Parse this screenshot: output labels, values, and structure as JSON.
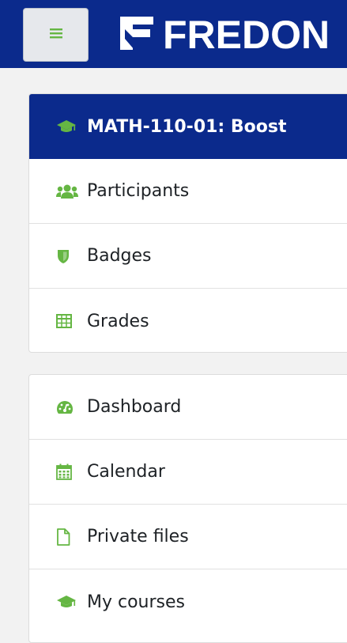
{
  "header": {
    "logo_text": "FREDON",
    "menu_icon": "hamburger-icon",
    "colors": {
      "bar": "#0b2a8c",
      "accent": "#65b643"
    }
  },
  "course_nav": {
    "items": [
      {
        "label": "MATH-110-01: Boost",
        "icon": "graduation-cap-icon",
        "active": true
      },
      {
        "label": "Participants",
        "icon": "users-icon"
      },
      {
        "label": "Badges",
        "icon": "shield-icon"
      },
      {
        "label": "Grades",
        "icon": "table-icon"
      }
    ]
  },
  "site_nav": {
    "items": [
      {
        "label": "Dashboard",
        "icon": "dashboard-icon"
      },
      {
        "label": "Calendar",
        "icon": "calendar-icon"
      },
      {
        "label": "Private files",
        "icon": "file-icon"
      },
      {
        "label": "My courses",
        "icon": "graduation-cap-icon"
      }
    ]
  }
}
